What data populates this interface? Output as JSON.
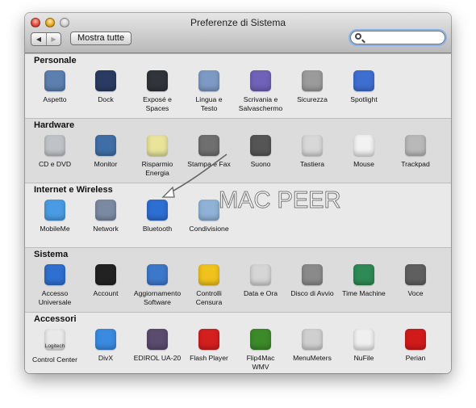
{
  "window": {
    "title": "Preferenze di Sistema"
  },
  "toolbar": {
    "back_icon": "back-arrow-icon",
    "forward_icon": "forward-arrow-icon",
    "show_all_label": "Mostra tutte",
    "search": {
      "placeholder": "",
      "value": ""
    }
  },
  "sections": [
    {
      "title": "Personale",
      "items": [
        {
          "label": "Aspetto",
          "icon": "appearance-icon",
          "color": "#5c7fb0"
        },
        {
          "label": "Dock",
          "icon": "dock-icon",
          "color": "#2a3b63"
        },
        {
          "label": "Exposé e\nSpaces",
          "icon": "expose-spaces-icon",
          "color": "#31343a"
        },
        {
          "label": "Lingua e\nTesto",
          "icon": "language-text-icon",
          "color": "#7d9ac4"
        },
        {
          "label": "Scrivania e\nSalvaschermo",
          "icon": "desktop-screensaver-icon",
          "color": "#6f62b8"
        },
        {
          "label": "Sicurezza",
          "icon": "security-icon",
          "color": "#9b9b9b"
        },
        {
          "label": "Spotlight",
          "icon": "spotlight-icon",
          "color": "#3f6ed1"
        }
      ]
    },
    {
      "title": "Hardware",
      "items": [
        {
          "label": "CD e DVD",
          "icon": "cd-dvd-icon",
          "color": "#bfc3c8"
        },
        {
          "label": "Monitor",
          "icon": "monitor-icon",
          "color": "#3f6ea6"
        },
        {
          "label": "Risparmio\nEnergia",
          "icon": "energy-saver-icon",
          "color": "#e9e49a"
        },
        {
          "label": "Stampa e Fax",
          "icon": "print-fax-icon",
          "color": "#6f6f6f"
        },
        {
          "label": "Suono",
          "icon": "sound-icon",
          "color": "#555555"
        },
        {
          "label": "Tastiera",
          "icon": "keyboard-icon",
          "color": "#d8d8d8"
        },
        {
          "label": "Mouse",
          "icon": "mouse-icon",
          "color": "#f2f2f2"
        },
        {
          "label": "Trackpad",
          "icon": "trackpad-icon",
          "color": "#b9b9b9"
        }
      ]
    },
    {
      "title": "Internet e Wireless",
      "items": [
        {
          "label": "MobileMe",
          "icon": "mobileme-icon",
          "color": "#4a9be3"
        },
        {
          "label": "Network",
          "icon": "network-icon",
          "color": "#7b8aa3"
        },
        {
          "label": "Bluetooth",
          "icon": "bluetooth-icon",
          "color": "#2d6ed3"
        },
        {
          "label": "Condivisione",
          "icon": "sharing-icon",
          "color": "#8fb2d6"
        }
      ]
    },
    {
      "title": "Sistema",
      "items": [
        {
          "label": "Accesso\nUniversale",
          "icon": "universal-access-icon",
          "color": "#2e6fcf"
        },
        {
          "label": "Account",
          "icon": "accounts-icon",
          "color": "#222222"
        },
        {
          "label": "Aggiornamento\nSoftware",
          "icon": "software-update-icon",
          "color": "#3c77c9"
        },
        {
          "label": "Controlli\nCensura",
          "icon": "parental-controls-icon",
          "color": "#f0c21c"
        },
        {
          "label": "Data e Ora",
          "icon": "date-time-icon",
          "color": "#d6d6d6"
        },
        {
          "label": "Disco di Avvio",
          "icon": "startup-disk-icon",
          "color": "#8a8a8a"
        },
        {
          "label": "Time Machine",
          "icon": "time-machine-icon",
          "color": "#2e8a56"
        },
        {
          "label": "Voce",
          "icon": "speech-icon",
          "color": "#5f5f5f"
        }
      ]
    },
    {
      "title": "Accessori",
      "items": [
        {
          "label": "Control Center",
          "icon": "logitech-control-center-icon",
          "color": "#e9e9e9",
          "sublabel": "Logitech"
        },
        {
          "label": "DivX",
          "icon": "divx-icon",
          "color": "#3a8ae0"
        },
        {
          "label": "EDIROL UA-20",
          "icon": "edirol-icon",
          "color": "#5a4b6f"
        },
        {
          "label": "Flash Player",
          "icon": "flash-player-icon",
          "color": "#d41f1f"
        },
        {
          "label": "Flip4Mac\nWMV",
          "icon": "flip4mac-icon",
          "color": "#3c8a2a"
        },
        {
          "label": "MenuMeters",
          "icon": "menumeters-icon",
          "color": "#cfcfcf"
        },
        {
          "label": "NuFile",
          "icon": "nufile-icon",
          "color": "#efefef"
        },
        {
          "label": "Perian",
          "icon": "perian-icon",
          "color": "#d11a1a"
        }
      ]
    }
  ],
  "watermark": "MAC PEER"
}
